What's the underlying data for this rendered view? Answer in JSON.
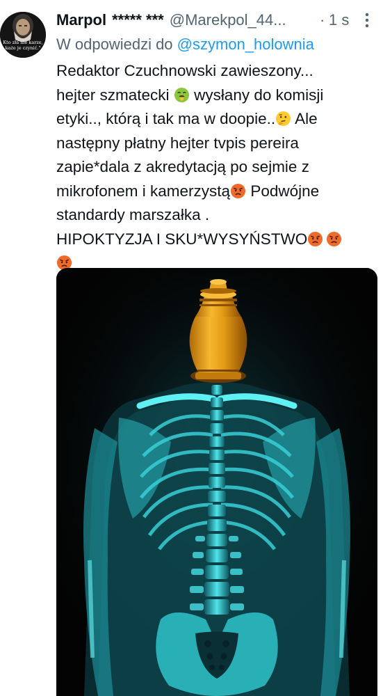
{
  "tweet": {
    "author": {
      "display_name": "Marpol",
      "badge_text": "***** ***",
      "handle": "@Marekpol_44...",
      "avatar_quote": "Kto zła nie karze,\nkaże je czynić.\""
    },
    "dot": "·",
    "timestamp": "1 s",
    "reply_prefix": "W odpowiedzi do",
    "reply_to": "@szymon_holownia",
    "text_lines": {
      "l1": "Redaktor Czuchnowski zawieszony...",
      "l2a": "hejter szmatecki ",
      "l2b": " wysłany do komisji",
      "l3a": "etyki.., którą i tak ma w doopie..",
      "l3b": " Ale",
      "l4": "następny płatny hejter tvpis pereira",
      "l5": "zapie*dala z akredytacją po sejmie  z",
      "l6a": "mikrofonem i kamerzystą",
      "l6b": " Podwójne",
      "l7": "standardy marszałka .",
      "l8": "HIPOKTYZJA I SKU*WYSYŃSTWO"
    },
    "emojis": {
      "vomit": "face-vomiting-emoji",
      "thinking": "thinking-face-emoji",
      "angry": "angry-face-emoji"
    },
    "media": {
      "description_icon": "xray-skeleton-with-urn-image"
    },
    "colors": {
      "link": "#1d9bf0",
      "muted": "#536471",
      "text": "#0f1419",
      "xray": "#2fd1d8",
      "urn": "#e8a21c"
    }
  }
}
